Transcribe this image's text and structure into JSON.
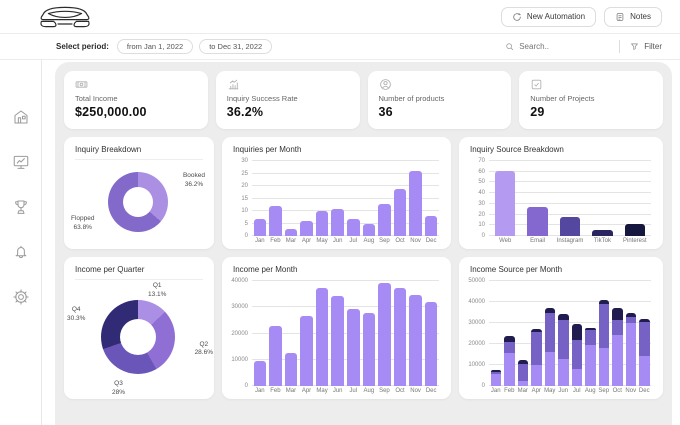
{
  "header": {
    "new_automation_label": "New Automation",
    "notes_label": "Notes"
  },
  "filter_bar": {
    "select_period_label": "Select period:",
    "date_from": "from Jan 1, 2022",
    "date_to": "to Dec 31, 2022",
    "search_placeholder": "Search..",
    "filter_label": "Filter"
  },
  "sidebar": {
    "items": [
      "home",
      "analytics",
      "achievements",
      "notifications",
      "settings"
    ]
  },
  "stats": [
    {
      "icon": "banknote-icon",
      "label": "Total Income",
      "value": "$250,000.00"
    },
    {
      "icon": "chart-up-icon",
      "label": "Inquiry Success Rate",
      "value": "36.2%"
    },
    {
      "icon": "user-circle-icon",
      "label": "Number of products",
      "value": "36"
    },
    {
      "icon": "check-square-icon",
      "label": "Number of Projects",
      "value": "29"
    }
  ],
  "colors": {
    "accent_light_purple": "#a78bf5",
    "medium_purple": "#7562c4",
    "dark_navy": "#201c50",
    "panel_gray": "#ededed"
  },
  "chart_data": [
    {
      "type": "pie",
      "title": "Inquiry Breakdown",
      "donut": true,
      "slices": [
        {
          "label": "Booked",
          "value": 36.2,
          "pct": "36.2%",
          "color": "#ab8fe3"
        },
        {
          "label": "Flopped",
          "value": 63.8,
          "pct": "63.8%",
          "color": "#8269ca"
        }
      ]
    },
    {
      "type": "bar",
      "title": "Inquiries per Month",
      "categories": [
        "Jan",
        "Feb",
        "Mar",
        "Apr",
        "May",
        "Jun",
        "Jul",
        "Aug",
        "Sep",
        "Oct",
        "Nov",
        "Dec"
      ],
      "values": [
        7,
        12,
        3,
        6,
        10,
        11,
        7,
        5,
        13,
        19,
        26,
        8
      ],
      "ylim": [
        0,
        30
      ],
      "yticks": [
        0,
        5,
        10,
        15,
        20,
        25,
        30
      ],
      "color": "#a78bf5",
      "grid": true,
      "legend": "none"
    },
    {
      "type": "bar",
      "title": "Inquiry Source Breakdown",
      "categories": [
        "Web",
        "Email",
        "Instagram",
        "TikTok",
        "Pinterest"
      ],
      "values": [
        61,
        27,
        18,
        6,
        11
      ],
      "ylim": [
        0,
        70
      ],
      "yticks": [
        0,
        10,
        20,
        30,
        40,
        50,
        60,
        70
      ],
      "colors": [
        "#b49af0",
        "#8468cf",
        "#54479f",
        "#2a2560",
        "#15173f"
      ],
      "grid": true,
      "legend": "none"
    },
    {
      "type": "pie",
      "title": "Income per Quarter",
      "donut": true,
      "slices": [
        {
          "label": "Q1",
          "value": 13.1,
          "pct": "13.1%",
          "color": "#ab8fe5"
        },
        {
          "label": "Q2",
          "value": 28.6,
          "pct": "28.6%",
          "color": "#8f6fd4"
        },
        {
          "label": "Q3",
          "value": 28.0,
          "pct": "28%",
          "color": "#6a55b8"
        },
        {
          "label": "Q4",
          "value": 30.3,
          "pct": "30.3%",
          "color": "#312a75"
        }
      ]
    },
    {
      "type": "bar",
      "title": "Income per Month",
      "categories": [
        "Jan",
        "Feb",
        "Mar",
        "Apr",
        "May",
        "Jun",
        "Jul",
        "Aug",
        "Sep",
        "Oct",
        "Nov",
        "Dec"
      ],
      "values": [
        9500,
        23000,
        12700,
        26700,
        37200,
        34300,
        29300,
        27700,
        39200,
        37500,
        34800,
        32000
      ],
      "ylim": [
        0,
        40000
      ],
      "yticks": [
        0,
        10000,
        20000,
        30000,
        40000
      ],
      "color": "#a78bf5",
      "grid": true,
      "legend": "none"
    },
    {
      "type": "stacked-bar",
      "title": "Income Source per Month",
      "categories": [
        "Jan",
        "Feb",
        "Mar",
        "Apr",
        "May",
        "Jun",
        "Jul",
        "Aug",
        "Sep",
        "Oct",
        "Nov",
        "Dec"
      ],
      "series": [
        {
          "name": "light-purple-source",
          "color": "#a78bf5",
          "values": [
            5800,
            15500,
            2500,
            10000,
            16000,
            13000,
            8000,
            19500,
            18000,
            24500,
            30000,
            14500
          ]
        },
        {
          "name": "medium-purple-source",
          "color": "#7562c4",
          "values": [
            1000,
            5500,
            8000,
            15500,
            19000,
            18500,
            14000,
            7000,
            21000,
            7000,
            2700,
            16000
          ]
        },
        {
          "name": "dark-navy-source",
          "color": "#201c50",
          "values": [
            800,
            3000,
            2000,
            1500,
            2000,
            2700,
            7300,
            1000,
            2000,
            5500,
            2000,
            1500
          ]
        }
      ],
      "ylim": [
        0,
        50000
      ],
      "yticks": [
        0,
        10000,
        20000,
        30000,
        40000,
        50000
      ],
      "grid": true,
      "legend": "none"
    }
  ]
}
